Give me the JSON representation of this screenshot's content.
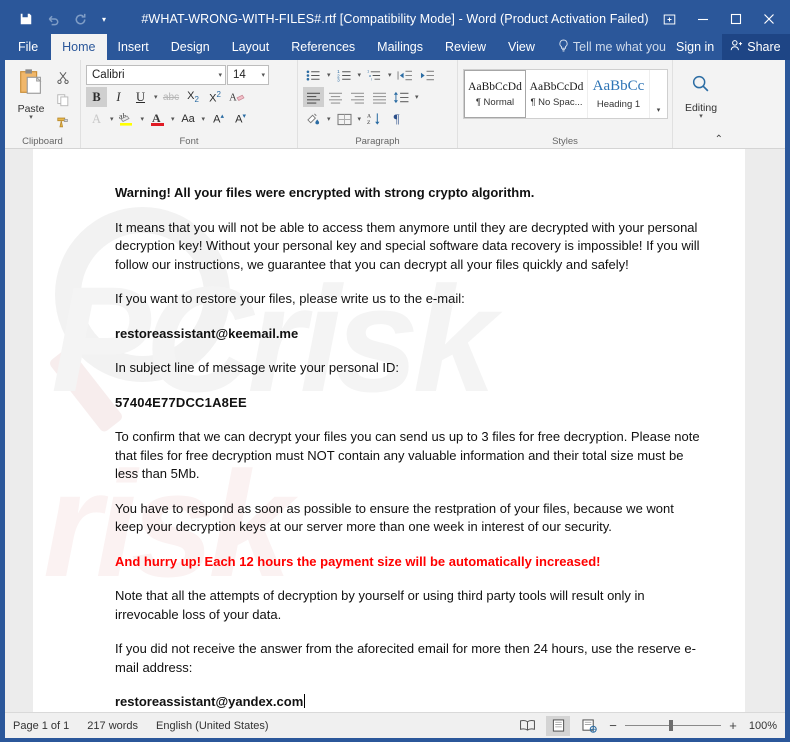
{
  "titlebar": {
    "document_title": "#WHAT-WRONG-WITH-FILES#.rtf [Compatibility Mode] - Word (Product Activation Failed)",
    "qat": [
      {
        "name": "save",
        "icon": "save-icon",
        "enabled": true
      },
      {
        "name": "undo",
        "icon": "undo-icon",
        "enabled": false
      },
      {
        "name": "redo",
        "icon": "redo-icon",
        "enabled": false
      },
      {
        "name": "customize",
        "icon": "chevron-down-icon",
        "enabled": true
      }
    ],
    "window_controls": [
      {
        "name": "ribbon-display-options",
        "icon": "ribbon-display-icon"
      },
      {
        "name": "minimize",
        "icon": "minimize-icon"
      },
      {
        "name": "maximize",
        "icon": "maximize-icon"
      },
      {
        "name": "close",
        "icon": "close-icon"
      }
    ]
  },
  "tabs": [
    {
      "label": "File",
      "active": false
    },
    {
      "label": "Home",
      "active": true
    },
    {
      "label": "Insert",
      "active": false
    },
    {
      "label": "Design",
      "active": false
    },
    {
      "label": "Layout",
      "active": false
    },
    {
      "label": "References",
      "active": false
    },
    {
      "label": "Mailings",
      "active": false
    },
    {
      "label": "Review",
      "active": false
    },
    {
      "label": "View",
      "active": false
    }
  ],
  "tellme": {
    "label": "Tell me what you",
    "icon": "lightbulb-icon"
  },
  "signin": {
    "label": "Sign in"
  },
  "share": {
    "label": "Share",
    "icon": "share-person-icon"
  },
  "ribbon": {
    "groups": [
      {
        "name": "clipboard",
        "label": "Clipboard"
      },
      {
        "name": "font",
        "label": "Font"
      },
      {
        "name": "paragraph",
        "label": "Paragraph"
      },
      {
        "name": "styles",
        "label": "Styles"
      },
      {
        "name": "editing",
        "label": "Editing"
      }
    ],
    "clipboard": {
      "paste_label": "Paste",
      "buttons": [
        "cut-icon",
        "copy-icon",
        "format-painter-icon"
      ]
    },
    "font": {
      "font_name": "Calibri",
      "font_size": "14",
      "bold_active": true,
      "buttons": [
        "bold-icon",
        "italic-icon",
        "underline-icon",
        "strikethrough-icon",
        "subscript-icon",
        "superscript-icon",
        "clear-formatting-icon",
        "text-effects-icon",
        "text-highlight-icon",
        "font-color-icon",
        "change-case-icon",
        "grow-font-icon",
        "shrink-font-icon"
      ]
    },
    "paragraph": {
      "buttons": [
        "bullets-icon",
        "numbering-icon",
        "multilevel-list-icon",
        "decrease-indent-icon",
        "increase-indent-icon",
        "align-left-icon",
        "align-center-icon",
        "align-right-icon",
        "justify-icon",
        "line-spacing-icon",
        "shading-icon",
        "borders-icon",
        "sort-icon",
        "show-marks-icon"
      ]
    },
    "styles": {
      "items": [
        {
          "preview": "AaBbCcDd",
          "name": "¶ Normal",
          "selected": true
        },
        {
          "preview": "AaBbCcDd",
          "name": "¶ No Spac...",
          "selected": false
        },
        {
          "preview": "AaBbCс",
          "name": "Heading 1",
          "selected": false
        }
      ],
      "more_icon": "chevron-down-icon"
    },
    "editing": {
      "label": "Editing",
      "icon": "search-icon"
    },
    "collapse_icon": "chevron-up-icon"
  },
  "document": {
    "paragraphs": [
      {
        "text": "Warning! All your files were encrypted with strong crypto algorithm.",
        "style": "bold"
      },
      {
        "text": "It means that you will not be able to access them anymore until they are decrypted with your personal decryption key! Without your personal key and special software data recovery is impossible! If you will follow our instructions, we guarantee that you can decrypt all your files quickly and safely!",
        "style": "normal"
      },
      {
        "text": "If you want to restore your files, please write us to the e-mail:",
        "style": "normal"
      },
      {
        "text": "restoreassistant@keemail.me",
        "style": "bold"
      },
      {
        "text": "In subject line of message write your personal ID:",
        "style": "normal"
      },
      {
        "text": "57404E77DCC1A8EE",
        "style": "id"
      },
      {
        "text": "To confirm that we can decrypt your files you can send us up to 3 files for free decryption. Please note that files for free decryption must NOT contain any valuable information and their total size must be less than 5Mb.",
        "style": "normal"
      },
      {
        "text": "You have to respond as soon as possible to ensure the restpration of your files, because we wont keep your decryption keys at our server more than one week in interest of our security.",
        "style": "normal"
      },
      {
        "text": "And hurry up! Each 12 hours the payment size will be automatically increased!",
        "style": "red"
      },
      {
        "text": "Note that all the attempts of decryption by yourself or using third party tools will result only in irrevocable loss of your data.",
        "style": "normal"
      },
      {
        "text": "If you did not receive the answer from the aforecited email for more then 24 hours, use the reserve e-mail address:",
        "style": "normal"
      },
      {
        "text": "restoreassistant@yandex.com",
        "style": "bold-caret"
      }
    ]
  },
  "statusbar": {
    "page": "Page 1 of 1",
    "words": "217 words",
    "language": "English (United States)",
    "views": [
      {
        "name": "read-mode",
        "icon": "read-mode-icon",
        "selected": false
      },
      {
        "name": "print-layout",
        "icon": "print-layout-icon",
        "selected": true
      },
      {
        "name": "web-layout",
        "icon": "web-layout-icon",
        "selected": false
      }
    ],
    "zoom_out": "−",
    "zoom_in": "+",
    "zoom_level": "100%"
  },
  "colors": {
    "title_blue": "#2b579a",
    "tab_active_bg": "#f3f3f3",
    "warning_red": "#ff0000",
    "ribbon_bg": "#f3f3f3"
  }
}
